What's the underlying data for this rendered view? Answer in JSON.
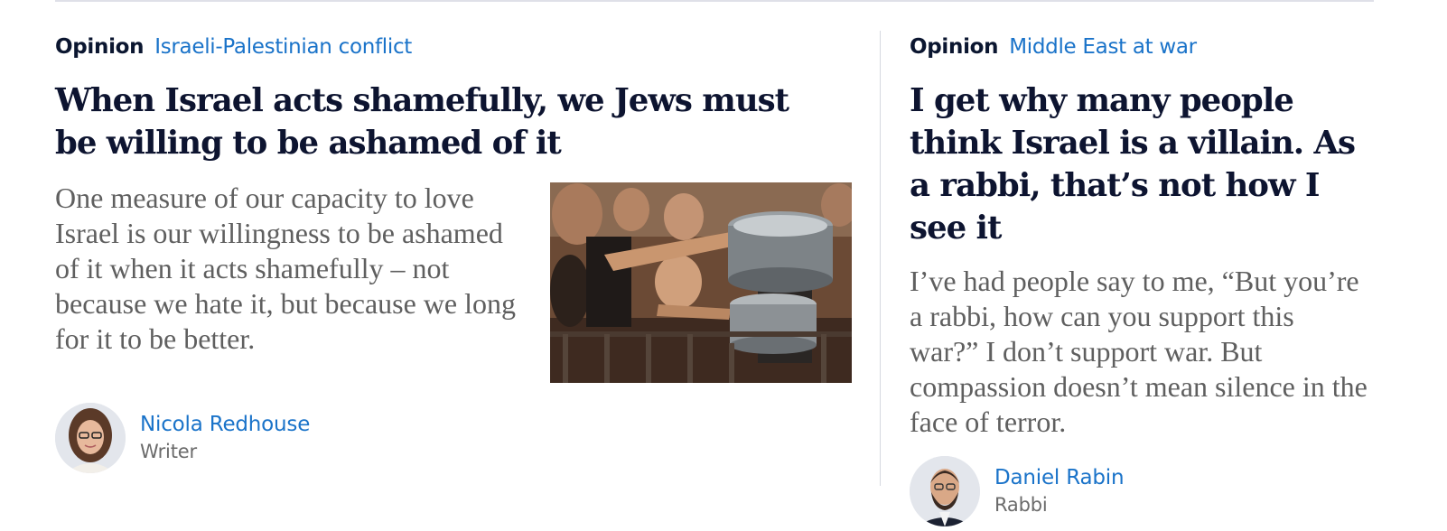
{
  "articles": [
    {
      "kicker_label": "Opinion",
      "kicker_topic": "Israeli-Palestinian conflict",
      "headline": "When Israel acts shamefully, we Jews must be willing to be ashamed of it",
      "standfirst": "One measure of our capacity to love Israel is our willingness to be ashamed of it when it acts shamefully – not because we hate it, but because we long for it to be better.",
      "author_name": "Nicola Redhouse",
      "author_role": "Writer"
    },
    {
      "kicker_label": "Opinion",
      "kicker_topic": "Middle East at war",
      "headline": "I get why many people think Israel is a villain. As a rabbi, that’s not how I see it",
      "standfirst": "I’ve had people say to me, “But you’re a rabbi, how can you support this war?” I don’t support war. But compassion doesn’t mean silence in the face of terror.",
      "author_name": "Daniel Rabin",
      "author_role": "Rabbi"
    }
  ],
  "colors": {
    "kicker_topic": "#1a73c9",
    "headline": "#0d1430",
    "standfirst": "#5f5f5f",
    "divider": "#d6d9e0"
  }
}
